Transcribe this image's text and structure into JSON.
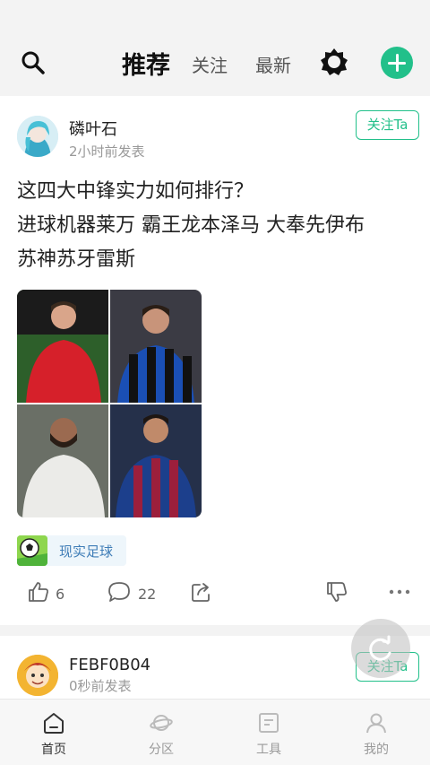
{
  "header": {
    "tabs": [
      {
        "label": "推荐",
        "active": true
      },
      {
        "label": "关注",
        "active": false
      },
      {
        "label": "最新",
        "active": false
      }
    ],
    "accent_color": "#22c08a"
  },
  "posts": [
    {
      "username": "磷叶石",
      "time": "2小时前发表",
      "follow_label": "关注Ta",
      "text_lines": [
        "这四大中锋实力如何排行？",
        "进球机器莱万   霸王龙本泽马   大奉先伊布",
        "苏神苏牙雷斯"
      ],
      "topic": "现实足球",
      "likes": "6",
      "comments": "22"
    },
    {
      "username": "FEBF0B04",
      "time": "0秒前发表",
      "follow_label": "关注Ta"
    }
  ],
  "bottom_nav": [
    {
      "label": "首页",
      "icon": "home-icon",
      "active": true
    },
    {
      "label": "分区",
      "icon": "planet-icon",
      "active": false
    },
    {
      "label": "工具",
      "icon": "tools-icon",
      "active": false
    },
    {
      "label": "我的",
      "icon": "profile-icon",
      "active": false
    }
  ]
}
